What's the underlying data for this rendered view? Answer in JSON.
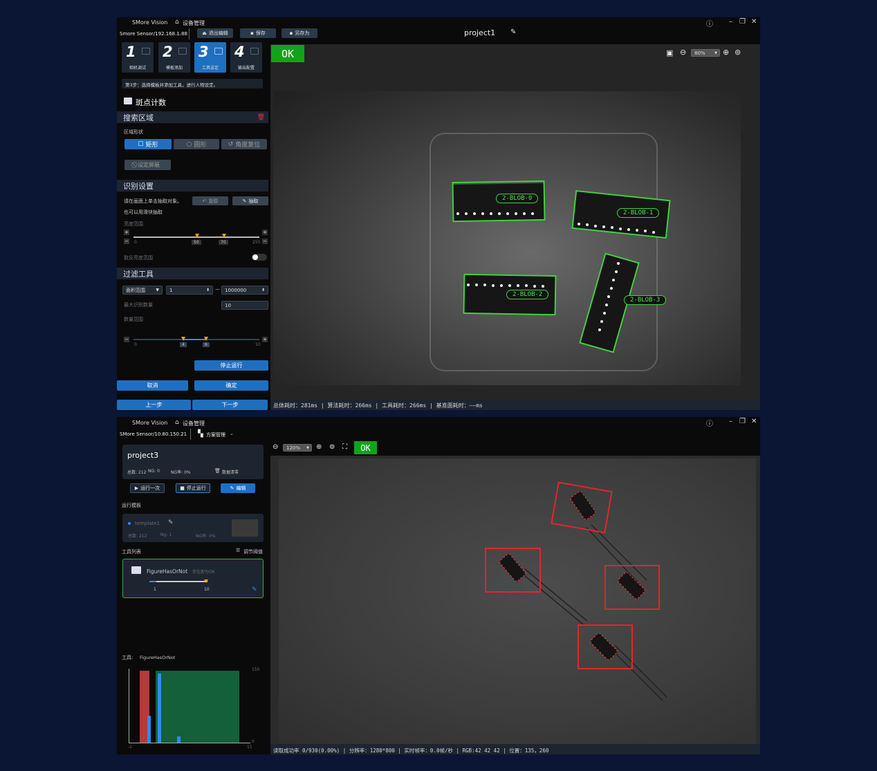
{
  "window1": {
    "brand": "SMore Vision",
    "device_mgmt": "设备管理",
    "sensor": "Smore Sensor/192.168.1.88",
    "buttons": {
      "exit_edit": "退出编辑",
      "save": "保存",
      "save_as": "另存为"
    },
    "project": "project1",
    "steps": [
      {
        "num": "1",
        "label": "相机调试"
      },
      {
        "num": "2",
        "label": "模板添加"
      },
      {
        "num": "3",
        "label": "工具设定"
      },
      {
        "num": "4",
        "label": "输出配置"
      }
    ],
    "step_hint": "第3步：选择模板并添加工具，进行人物设定。",
    "tool_title": "斑点计数",
    "search_area": {
      "title": "搜索区域",
      "shape_label": "区域形状",
      "rect": "矩形",
      "circle": "圆形",
      "angle_reset": "角度复位",
      "mask": "设定屏蔽"
    },
    "recognition": {
      "title": "识别设置",
      "hint1": "请在画面上单击抽取对象。",
      "hint2": "也可以用滑块抽取",
      "reset": "复原",
      "extract": "抽取",
      "brightness_label": "亮度范围",
      "slider_min": "0",
      "slider_low": "50",
      "slider_high": "70",
      "slider_max": "255",
      "invert_label": "取反亮度范围"
    },
    "filter": {
      "title": "过滤工具",
      "area_select": "面积范围",
      "min_value": "1",
      "max_value": "1000000",
      "max_count_label": "最大识别数量",
      "max_count": "10",
      "count_range_label": "数量范围",
      "cnt_min": "0",
      "cnt_low": "4",
      "cnt_high": "6",
      "cnt_max": "10"
    },
    "stop_run": "停止运行",
    "cancel": "取消",
    "confirm": "确定",
    "prev": "上一步",
    "next": "下一步",
    "result": "OK",
    "zoom": "80%",
    "blob_labels": [
      "2-BLOB-0",
      "2-BLOB-1",
      "2-BLOB-2",
      "2-BLOB-3"
    ],
    "status": "总体耗时：281ms  |  算法耗时：266ms  |  工具耗时：266ms  |  基准面耗时：——ms"
  },
  "window2": {
    "brand": "SMore Vision",
    "device_mgmt": "设备管理",
    "sensor": "SMore Sensor/10.80.150.21",
    "scheme_mgmt": "方案管理",
    "project": "project3",
    "stats": {
      "total": "总数: 212",
      "ng": "NG: 0",
      "ng_rate": "NG率: 0%",
      "clear": "数据清零"
    },
    "buttons": {
      "run_once": "运行一次",
      "stop": "停止运行",
      "edit": "编辑"
    },
    "template_section": "运行模板",
    "template": {
      "name": "template1",
      "total": "总数: 212",
      "ng": "Ng: 1",
      "ng_rate": "NG率: 0%"
    },
    "tool_list": "工具列表",
    "adjust_threshold": "调节阈值",
    "tool": {
      "name": "FigureHasOrNot",
      "hint": "存在即为OK",
      "min": "1",
      "max": "10"
    },
    "tool_label": "工具:",
    "tool_value": "FigureHasOrNot",
    "hist": {
      "y_max": "150",
      "y_min": "0",
      "x_min": "-1",
      "x_max": "11"
    },
    "zoom": "120%",
    "result": "OK",
    "status": "读取成功率 0/930(0.00%) | 分辨率：1280*800 | 实时帧率：0.0帧/秒 | RGB:42 42 42 | 位置：135，260"
  },
  "colors": {
    "ok_green": "#12a31c",
    "accent_blue": "#1f6fc0",
    "blob_green": "#3fd43a",
    "detect_red": "#e3252b",
    "page_bg": "#0b1534"
  }
}
